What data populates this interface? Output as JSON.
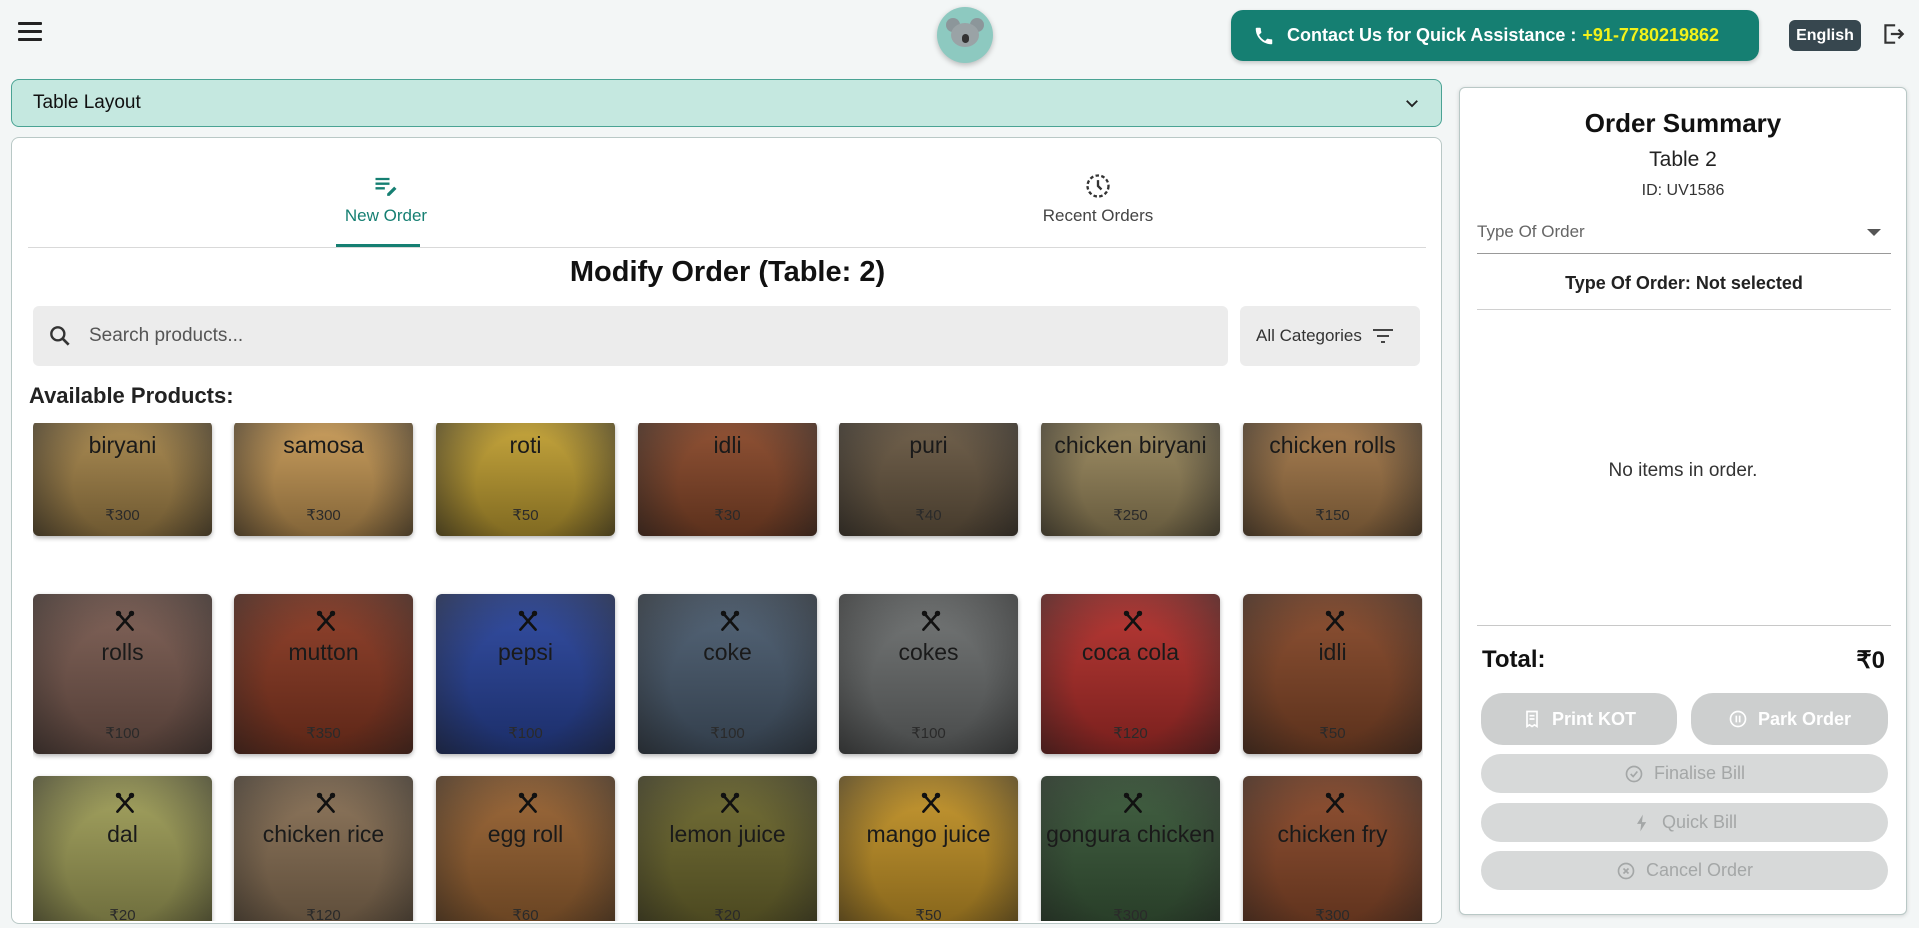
{
  "header": {
    "contact_label": "Contact Us for Quick Assistance : ",
    "contact_number": "+91-7780219862",
    "language": "English"
  },
  "accordion": {
    "label": "Table Layout"
  },
  "tabs": [
    {
      "label": "New Order",
      "icon": "edit-list-icon",
      "active": true
    },
    {
      "label": "Recent Orders",
      "icon": "clock-history-icon",
      "active": false
    }
  ],
  "main": {
    "heading": "Modify Order (Table: 2)",
    "search_placeholder": "Search products...",
    "categories_label": "All Categories",
    "available_label": "Available Products:"
  },
  "products": [
    {
      "name": "biryani",
      "price": "₹300",
      "color": "#a8874b"
    },
    {
      "name": "samosa",
      "price": "₹300",
      "color": "#c89a56"
    },
    {
      "name": "roti",
      "price": "₹50",
      "color": "#c4a233"
    },
    {
      "name": "idli",
      "price": "₹30",
      "color": "#8c4a2b"
    },
    {
      "name": "puri",
      "price": "₹40",
      "color": "#6b5a44"
    },
    {
      "name": "chicken biryani",
      "price": "₹250",
      "color": "#9c8a5e"
    },
    {
      "name": "chicken rolls",
      "price": "₹150",
      "color": "#a67a4a"
    },
    {
      "name": "rolls",
      "price": "₹100",
      "color": "#7d5d52"
    },
    {
      "name": "mutton",
      "price": "₹350",
      "color": "#8d3a23"
    },
    {
      "name": "pepsi",
      "price": "₹100",
      "color": "#2a46a0"
    },
    {
      "name": "coke",
      "price": "₹100",
      "color": "#4d5f73"
    },
    {
      "name": "cokes",
      "price": "₹100",
      "color": "#6f7272"
    },
    {
      "name": "coca cola",
      "price": "₹120",
      "color": "#b8302c"
    },
    {
      "name": "idli",
      "price": "₹50",
      "color": "#8a4a2a"
    },
    {
      "name": "dal",
      "price": "₹20",
      "color": "#a3a25a"
    },
    {
      "name": "chicken rice",
      "price": "₹120",
      "color": "#8b7256"
    },
    {
      "name": "egg roll",
      "price": "₹60",
      "color": "#9b6432"
    },
    {
      "name": "lemon juice",
      "price": "₹20",
      "color": "#6f6a2e"
    },
    {
      "name": "mango juice",
      "price": "₹50",
      "color": "#c79628"
    },
    {
      "name": "gongura chicken",
      "price": "₹300",
      "color": "#3a5a3a"
    },
    {
      "name": "chicken fry",
      "price": "₹300",
      "color": "#8d4a2a"
    }
  ],
  "summary": {
    "title": "Order Summary",
    "table": "Table 2",
    "id": "ID: UV1586",
    "type_placeholder": "Type Of Order",
    "type_status": "Type Of Order: Not selected",
    "empty": "No items in order.",
    "total_label": "Total:",
    "total_value": "₹0",
    "buttons": {
      "print_kot": "Print KOT",
      "park_order": "Park Order",
      "finalise": "Finalise Bill",
      "quick": "Quick Bill",
      "cancel": "Cancel Order"
    }
  }
}
